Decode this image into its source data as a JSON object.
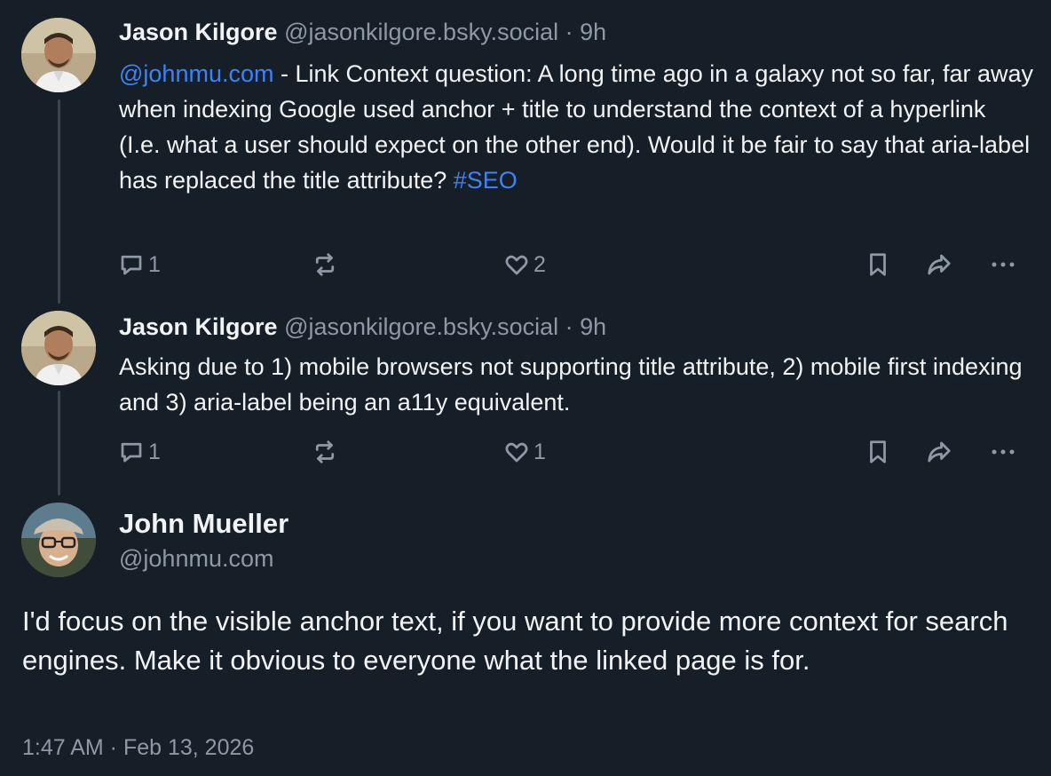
{
  "posts": [
    {
      "author": "Jason Kilgore",
      "handle": "@jasonkilgore.bsky.social",
      "separator": "·",
      "time": "9h",
      "text_mention": "@johnmu.com",
      "text_body": " - Link Context question: A long time ago in a galaxy not so far, far away when indexing Google used anchor + title to understand the context of a hyperlink (I.e. what a user should expect on the other end).  Would it be fair to say that aria-label has replaced the title attribute? ",
      "text_hashtag": "#SEO",
      "reply_count": "1",
      "like_count": "2"
    },
    {
      "author": "Jason Kilgore",
      "handle": "@jasonkilgore.bsky.social",
      "separator": "·",
      "time": "9h",
      "text_body": "Asking due to 1) mobile browsers not supporting title attribute, 2) mobile first indexing and 3) aria-label being an a11y equivalent.",
      "reply_count": "1",
      "like_count": "1"
    }
  ],
  "main_post": {
    "author": "John Mueller",
    "handle": "@johnmu.com",
    "text": "I'd focus on the visible anchor text, if you want to provide more context for search engines. Make it obvious to everyone what the linked page is for.",
    "timestamp": "1:47 AM · Feb 13, 2026"
  },
  "icons": {
    "reply": "reply-icon",
    "repost": "repost-icon",
    "like": "heart-icon",
    "bookmark": "bookmark-icon",
    "share": "share-icon",
    "more": "more-icon"
  },
  "colors": {
    "background": "#161e27",
    "text": "#f1f3f5",
    "muted": "#8d99a6",
    "link": "#3d82f6",
    "thread_line": "#3b4552"
  }
}
